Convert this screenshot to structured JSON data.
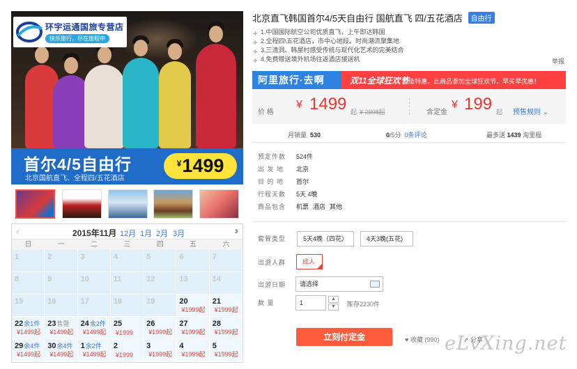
{
  "hero": {
    "logo_name": "环宇运通国旅专营店",
    "logo_slogan": "快乐旅行，尽在旅程中",
    "banner_title": "首尔4/5自由行",
    "banner_subtitle": "北京国航直飞、全程四/五花酒店",
    "banner_price_symbol": "¥",
    "banner_price": "1499"
  },
  "thumbnails": [
    "thumb-1",
    "thumb-2",
    "thumb-3",
    "thumb-4",
    "thumb-5"
  ],
  "calendar": {
    "prev": "‹",
    "month": "2015年11月",
    "tabs": [
      "12月",
      "1月",
      "2月",
      "3月"
    ],
    "next": "›",
    "weekdays": [
      "日",
      "一",
      "二",
      "三",
      "四",
      "五",
      "六"
    ],
    "weeks": [
      [
        {
          "d": "1"
        },
        {
          "d": "2"
        },
        {
          "d": "3"
        },
        {
          "d": "4"
        },
        {
          "d": "5"
        },
        {
          "d": "6"
        },
        {
          "d": "7"
        }
      ],
      [
        {
          "d": "8"
        },
        {
          "d": "9"
        },
        {
          "d": "10"
        },
        {
          "d": "11"
        },
        {
          "d": "12"
        },
        {
          "d": "13"
        },
        {
          "d": "14"
        }
      ],
      [
        {
          "d": "15"
        },
        {
          "d": "16"
        },
        {
          "d": "17"
        },
        {
          "d": "18"
        },
        {
          "d": "19"
        },
        {
          "d": "20",
          "p": "¥1999起",
          "s": "avail"
        },
        {
          "d": "21",
          "p": "¥1999起",
          "s": "avail"
        }
      ],
      [
        {
          "d": "22",
          "t": "余1件",
          "p": "¥1499起",
          "s": "avail"
        },
        {
          "d": "23",
          "t": "售罄",
          "p": "¥1499起",
          "s": "sold"
        },
        {
          "d": "24",
          "t": "余2件",
          "p": "¥1499起",
          "s": "avail"
        },
        {
          "d": "25",
          "p": "¥1999",
          "s": "avail"
        },
        {
          "d": "26",
          "p": "¥1999起",
          "s": "avail"
        },
        {
          "d": "27",
          "p": "¥1999起",
          "s": "avail"
        },
        {
          "d": "28",
          "p": "¥1999起",
          "s": "avail"
        }
      ],
      [
        {
          "d": "29",
          "t": "余4件",
          "p": "¥1499起",
          "s": "avail"
        },
        {
          "d": "30",
          "t": "余4件",
          "p": "¥1499起",
          "s": "avail"
        },
        {
          "d": "1",
          "t": "余2件",
          "p": "¥1499起",
          "s": "avail"
        },
        {
          "d": "2",
          "p": "¥1999",
          "s": "avail"
        },
        {
          "d": "3",
          "p": "¥1999起",
          "s": "avail"
        },
        {
          "d": "4",
          "p": "¥1999起",
          "s": "avail"
        },
        {
          "d": "5",
          "p": "¥1999起",
          "s": "avail"
        }
      ]
    ]
  },
  "product": {
    "title": "北京直飞韩国首尔4/5天自由行 国航直飞 四/五花酒店",
    "badge": "自由行",
    "features": [
      "1.中国国际航空公司优质直飞，上午即达韩国",
      "2.全程四\\五花酒店，市中心地段。时尚潮流聚集地",
      "3.三清洞、韩屋村感受传统与现代化艺术的完美结合",
      "4.免费赠送境外机场往返酒店接送机"
    ],
    "report": "举报"
  },
  "alitrip": {
    "logo": "阿里旅行·去啊",
    "event": "双11全球狂欢节",
    "note": "超级特惠，此商品参加全球狂欢节，早买早优惠！"
  },
  "price": {
    "label": "价  格",
    "symbol": "¥",
    "value": "1499",
    "suffix": "起",
    "original": "¥ 2998起",
    "deposit_label": "含定金",
    "deposit_value": "199",
    "deposit_suffix": "起",
    "rule": "预售规则"
  },
  "stats": {
    "sales_label": "月销量",
    "sales": "530",
    "rating": "0",
    "rating_total": "/5分",
    "comments": "0条评论",
    "points_prefix": "最多送",
    "points": "1439",
    "points_suffix": "淘里程"
  },
  "info": [
    {
      "k": "预定件数",
      "v": [
        "524件"
      ]
    },
    {
      "k": "出 发 地",
      "v": [
        "北京"
      ]
    },
    {
      "k": "目 的 地",
      "v": [
        "首尔"
      ]
    },
    {
      "k": "行程天数",
      "v": [
        "5天 4晚"
      ]
    },
    {
      "k": "商品包含",
      "v": [
        "机票",
        "酒店",
        "其他"
      ]
    }
  ],
  "options": {
    "package_label": "套餐类型",
    "packages": [
      "5天4晚（四花）",
      "4天3晚(五花)"
    ],
    "group_label": "出游人群",
    "group_selected": "成人",
    "date_label": "出游日期",
    "date_value": "请选择",
    "qty_label": "数    量",
    "qty_value": "1",
    "stock": "库存2230件"
  },
  "actions": {
    "buy": "立刻付定金",
    "favorite": "收藏",
    "favorite_count": "(990)",
    "share": "分享"
  },
  "watermark": "eLvXing.net"
}
